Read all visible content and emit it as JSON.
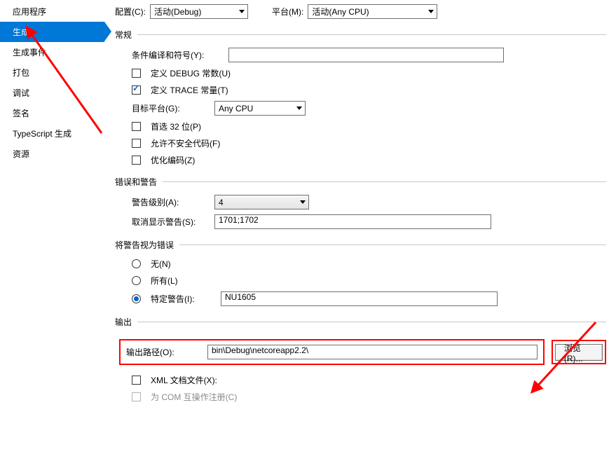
{
  "sidebar": {
    "items": [
      {
        "label": "应用程序"
      },
      {
        "label": "生成"
      },
      {
        "label": "生成事件"
      },
      {
        "label": "打包"
      },
      {
        "label": "调试"
      },
      {
        "label": "签名"
      },
      {
        "label": "TypeScript 生成"
      },
      {
        "label": "资源"
      }
    ],
    "active_index": 1
  },
  "top": {
    "config_label": "配置(C):",
    "config_value": "活动(Debug)",
    "platform_label": "平台(M):",
    "platform_value": "活动(Any CPU)"
  },
  "sections": {
    "general": "常规",
    "errwarn": "错误和警告",
    "treat": "将警告视为错误",
    "output": "输出"
  },
  "general": {
    "cond_label": "条件编译和符号(Y):",
    "cond_value": "",
    "def_debug": "定义 DEBUG 常数(U)",
    "def_trace": "定义 TRACE 常量(T)",
    "target_label": "目标平台(G):",
    "target_value": "Any CPU",
    "prefer32": "首选 32 位(P)",
    "unsafe": "允许不安全代码(F)",
    "optimize": "优化编码(Z)"
  },
  "errwarn": {
    "level_label": "警告级别(A):",
    "level_value": "4",
    "supp_label": "取消显示警告(S):",
    "supp_value": "1701;1702"
  },
  "treat": {
    "none": "无(N)",
    "all": "所有(L)",
    "specific": "特定警告(I):",
    "specific_value": "NU1605"
  },
  "output": {
    "path_label": "输出路径(O):",
    "path_value": "bin\\Debug\\netcoreapp2.2\\",
    "browse": "浏览(R)...",
    "xmldoc": "XML 文档文件(X):",
    "com": "为 COM 互操作注册(C)"
  }
}
